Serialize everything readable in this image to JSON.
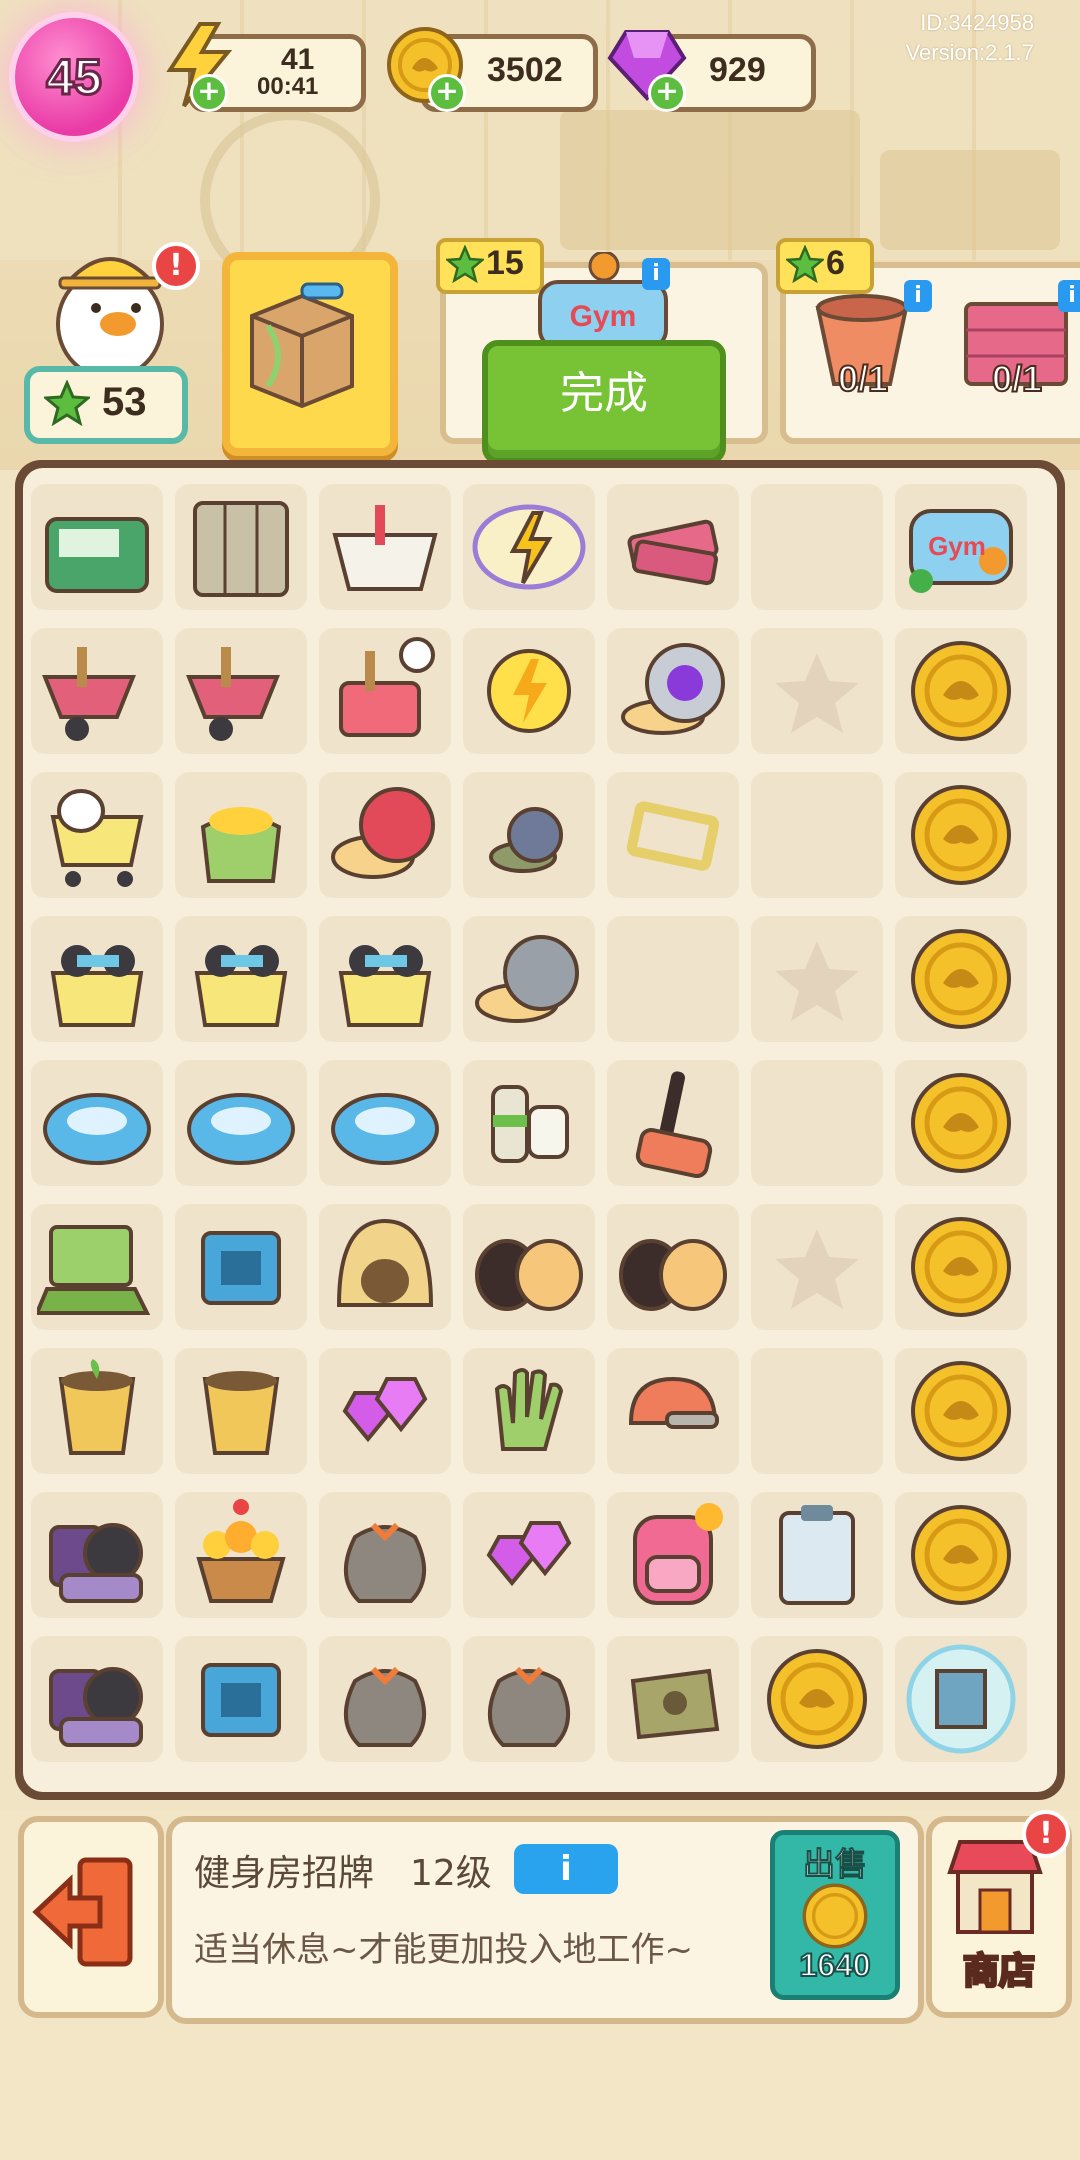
{
  "hud": {
    "level": "45",
    "energy": {
      "value": "41",
      "timer": "00:41"
    },
    "coins": "3502",
    "gems": "929",
    "meta": {
      "id": "ID:3424958",
      "version": "Version:2.1.7"
    }
  },
  "orders": {
    "player_stars": "53",
    "order1": {
      "stars": "15",
      "done_label": "完成"
    },
    "order2": {
      "stars": "6",
      "items": [
        {
          "progress": "0/1"
        },
        {
          "progress": "0/1"
        }
      ]
    }
  },
  "board": {
    "rows": [
      [
        "cash-register",
        "locker-cabinet",
        "toolbox-open",
        "energy-orb",
        "bricks",
        "empty",
        "gym-sign"
      ],
      [
        "wheelbarrow",
        "wheelbarrow",
        "timed-toolbox",
        "energy-coin",
        "snail-helmet",
        "star-slot",
        "coin"
      ],
      [
        "shopping-cart-duck",
        "sack-gold",
        "cat-snail",
        "small-snail",
        "frame",
        "empty",
        "coin"
      ],
      [
        "dumbbell-basket",
        "dumbbell-basket",
        "dumbbell-basket",
        "gray-snail",
        "empty",
        "star-slot",
        "coin"
      ],
      [
        "robot-vacuum",
        "robot-vacuum",
        "robot-vacuum",
        "spray-bottles",
        "mallet",
        "empty",
        "coin"
      ],
      [
        "laptop",
        "cpu-chip",
        "cat-bed",
        "hamsters",
        "hamster-family",
        "star-slot",
        "coin"
      ],
      [
        "plant-pot",
        "empty-pot",
        "pink-gems",
        "glove",
        "helmet-tool",
        "empty",
        "coin"
      ],
      [
        "bag-pile",
        "flower-basket",
        "garbage-bag",
        "purple-gems",
        "backpack",
        "clipboard",
        "coin"
      ],
      [
        "bag-pile",
        "circuit-board",
        "garbage-bag",
        "garbage-bag",
        "seed-bag",
        "coin",
        "building-bubble"
      ]
    ]
  },
  "info": {
    "item_name": "健身房招牌",
    "item_level": "12级",
    "info_button": "i",
    "description": "适当休息~才能更加投入地工作~",
    "sell_label": "出售",
    "sell_price": "1640",
    "shop_label": "商店"
  },
  "colors": {
    "accent_green": "#78c236",
    "coin": "#f5c12a",
    "gem": "#c24ce0",
    "board_border": "#6b4b35"
  }
}
